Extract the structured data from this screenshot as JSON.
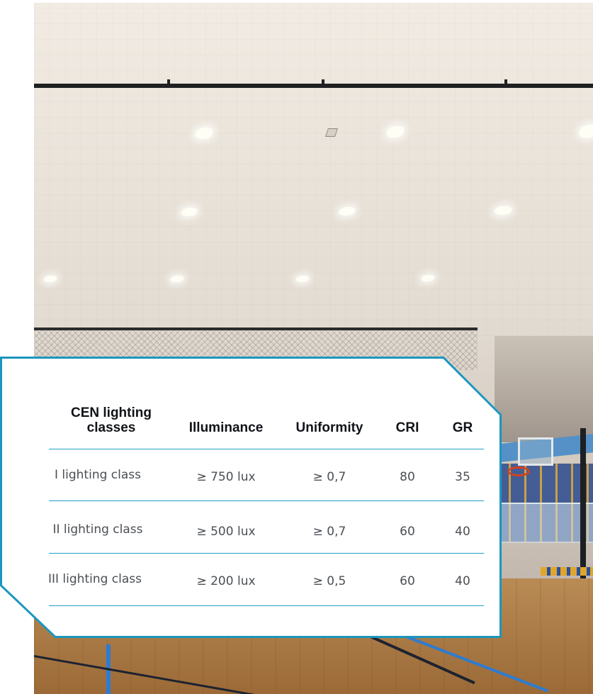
{
  "table": {
    "columns": [
      "CEN lighting classes",
      "Illuminance",
      "Uniformity",
      "CRI",
      "GR"
    ],
    "rows": [
      [
        "I lighting class",
        "≥ 750 lux",
        "≥ 0,7",
        "80",
        "35"
      ],
      [
        "II lighting class",
        "≥ 500 lux",
        "≥ 0,7",
        "60",
        "40"
      ],
      [
        "III lighting class",
        "≥ 200 lux",
        "≥ 0,5",
        "60",
        "40"
      ]
    ]
  },
  "colors": {
    "accent": "#1d96bd",
    "divider": "#22a0c4",
    "header_text": "#101317",
    "cell_text": "#4b4f54"
  }
}
